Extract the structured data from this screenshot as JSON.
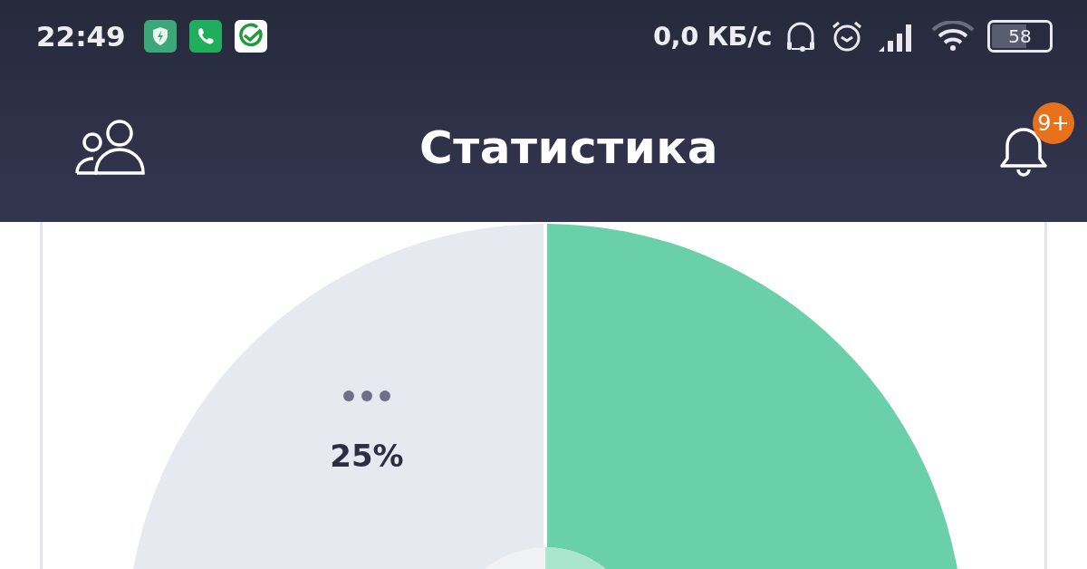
{
  "status_bar": {
    "time": "22:49",
    "notifications": [
      {
        "kind": "shield"
      },
      {
        "kind": "phone"
      },
      {
        "kind": "check"
      }
    ],
    "speed": "0,0 КБ/с",
    "battery": "58"
  },
  "app_bar": {
    "title": "Статистика",
    "badge": "9+"
  },
  "pie": {
    "segments": [
      {
        "label": "25%",
        "color": "#e6e9ef"
      },
      {
        "color": "#6acfab"
      }
    ]
  }
}
